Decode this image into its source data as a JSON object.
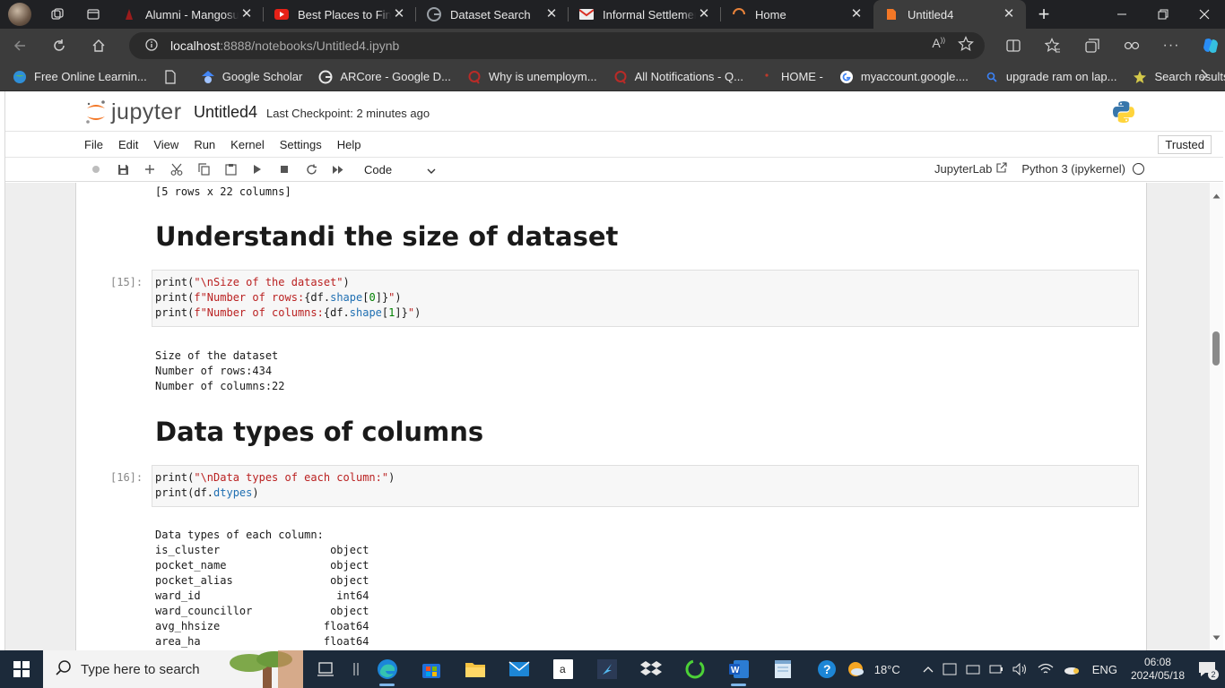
{
  "browser": {
    "tabs": [
      {
        "title": "Alumni - Mangosuthu",
        "favicon": "mangosuthu-icon"
      },
      {
        "title": "Best Places to Find D",
        "favicon": "youtube-icon"
      },
      {
        "title": "Dataset Search",
        "favicon": "google-icon"
      },
      {
        "title": "Informal Settlement",
        "favicon": "gmail-icon"
      },
      {
        "title": "Home",
        "favicon": "loading-icon"
      },
      {
        "title": "Untitled4",
        "favicon": "jupyter-icon",
        "active": true
      }
    ],
    "url_host": "localhost",
    "url_path": ":8888/notebooks/Untitled4.ipynb",
    "bookmarks": [
      {
        "label": "Free Online Learnin...",
        "icon": "globe-icon"
      },
      {
        "label": "",
        "icon": "page-icon"
      },
      {
        "label": "Google Scholar",
        "icon": "scholar-icon"
      },
      {
        "label": "ARCore - Google D...",
        "icon": "google-icon"
      },
      {
        "label": "Why is unemploym...",
        "icon": "quora-icon"
      },
      {
        "label": "All Notifications - Q...",
        "icon": "quora-icon"
      },
      {
        "label": "HOME -",
        "icon": "red-dot-icon"
      },
      {
        "label": "myaccount.google....",
        "icon": "google-icon"
      },
      {
        "label": "upgrade ram on lap...",
        "icon": "search-icon"
      },
      {
        "label": "Search results for: '...",
        "icon": "star-icon"
      }
    ]
  },
  "jupyter": {
    "logo_text": "jupyter",
    "notebook_title": "Untitled4",
    "checkpoint": "Last Checkpoint: 2 minutes ago",
    "menu": [
      "File",
      "Edit",
      "View",
      "Run",
      "Kernel",
      "Settings",
      "Help"
    ],
    "trusted": "Trusted",
    "cell_type": "Code",
    "jupyterlab_link": "JupyterLab",
    "kernel_name": "Python 3 (ipykernel)"
  },
  "notebook": {
    "prev_output": "[5 rows x 22 columns]",
    "heading1": "Understandi the size of dataset",
    "cell15": {
      "prompt": "[15]:",
      "output": "Size of the dataset\nNumber of rows:434\nNumber of columns:22"
    },
    "heading2": "Data types of columns",
    "cell16": {
      "prompt": "[16]:",
      "output": "Data types of each column:\nis_cluster                 object\npocket_name                object\npocket_alias               object\nward_id                     int64\nward_councillor            object\navg_hhsize                float64\narea_ha                   float64"
    }
  },
  "taskbar": {
    "search_placeholder": "Type here to search",
    "weather": "18°C",
    "language": "ENG",
    "time": "06:08",
    "date": "2024/05/18",
    "notifications": "2"
  }
}
